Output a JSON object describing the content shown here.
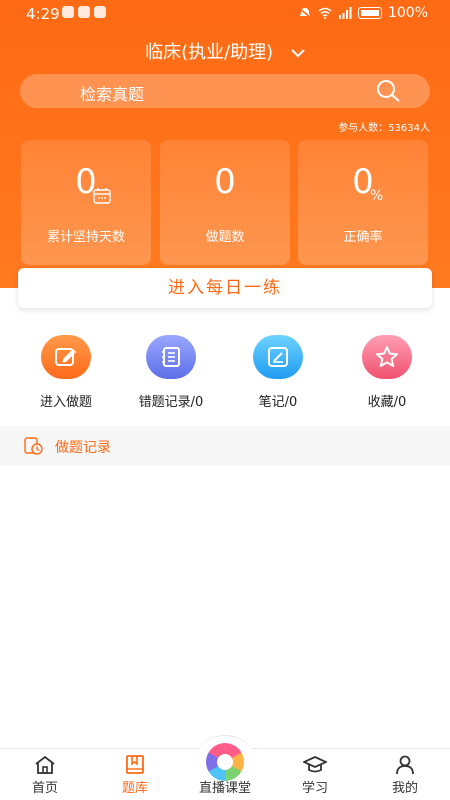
{
  "status_bar": {
    "time": "4:29",
    "battery": "100%"
  },
  "header": {
    "title": "临床(执业/助理)",
    "search_placeholder": "检索真题",
    "participants": "参与人数：53634人"
  },
  "stats": [
    {
      "value": "0",
      "label": "累计坚持天数"
    },
    {
      "value": "0",
      "label": "做题数"
    },
    {
      "value": "0",
      "label": "正确率",
      "unit": "%"
    }
  ],
  "daily_practice_label": "进入每日一练",
  "features": [
    {
      "label": "进入做题",
      "icon": "edit-icon",
      "color": "#ff7a24"
    },
    {
      "label": "错题记录/0",
      "icon": "notebook-icon",
      "color": "#6b7cf0"
    },
    {
      "label": "笔记/0",
      "icon": "note-icon",
      "color": "#2aa6f4"
    },
    {
      "label": "收藏/0",
      "icon": "star-icon",
      "color": "#f25a78"
    }
  ],
  "record_section": {
    "label": "做题记录"
  },
  "bottom_nav": [
    {
      "label": "首页",
      "icon": "home-icon"
    },
    {
      "label": "题库",
      "icon": "book-icon",
      "active": true
    },
    {
      "label": "直播课堂",
      "icon": "live-icon"
    },
    {
      "label": "学习",
      "icon": "graduation-cap-icon"
    },
    {
      "label": "我的",
      "icon": "person-icon"
    }
  ],
  "colors": {
    "brand": "#ff6a14",
    "record_bg": "#f7f7f7"
  }
}
